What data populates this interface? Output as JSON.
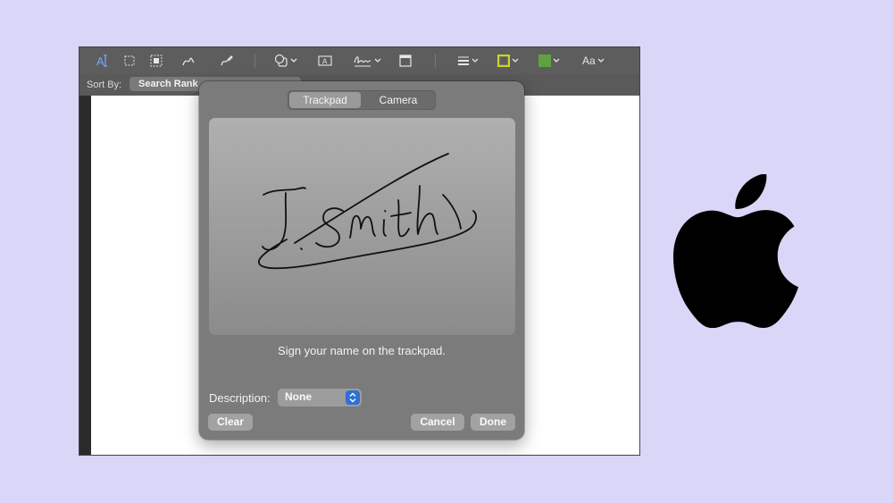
{
  "toolbar": {
    "icons": [
      "text-selection-icon",
      "rect-selection-icon",
      "instant-alpha-icon",
      "sketch-icon",
      "draw-icon",
      "shapes-icon",
      "text-box-icon",
      "signature-icon",
      "note-icon",
      "line-style-icon",
      "border-color-icon",
      "fill-color-icon",
      "font-icon"
    ],
    "font_label": "Aa",
    "border_color": "#c8d42a",
    "fill_color": "#5fa341"
  },
  "sortbar": {
    "label": "Sort By:",
    "button": "Search Rank"
  },
  "signature_dialog": {
    "tabs": [
      {
        "label": "Trackpad",
        "active": true
      },
      {
        "label": "Camera",
        "active": false
      }
    ],
    "hint": "Sign your name on the trackpad.",
    "description_label": "Description:",
    "description_value": "None",
    "clear_label": "Clear",
    "cancel_label": "Cancel",
    "done_label": "Done"
  },
  "colors": {
    "background": "#d9d6f7",
    "select_accent": "#2f6fd6"
  },
  "logo": "apple-logo"
}
